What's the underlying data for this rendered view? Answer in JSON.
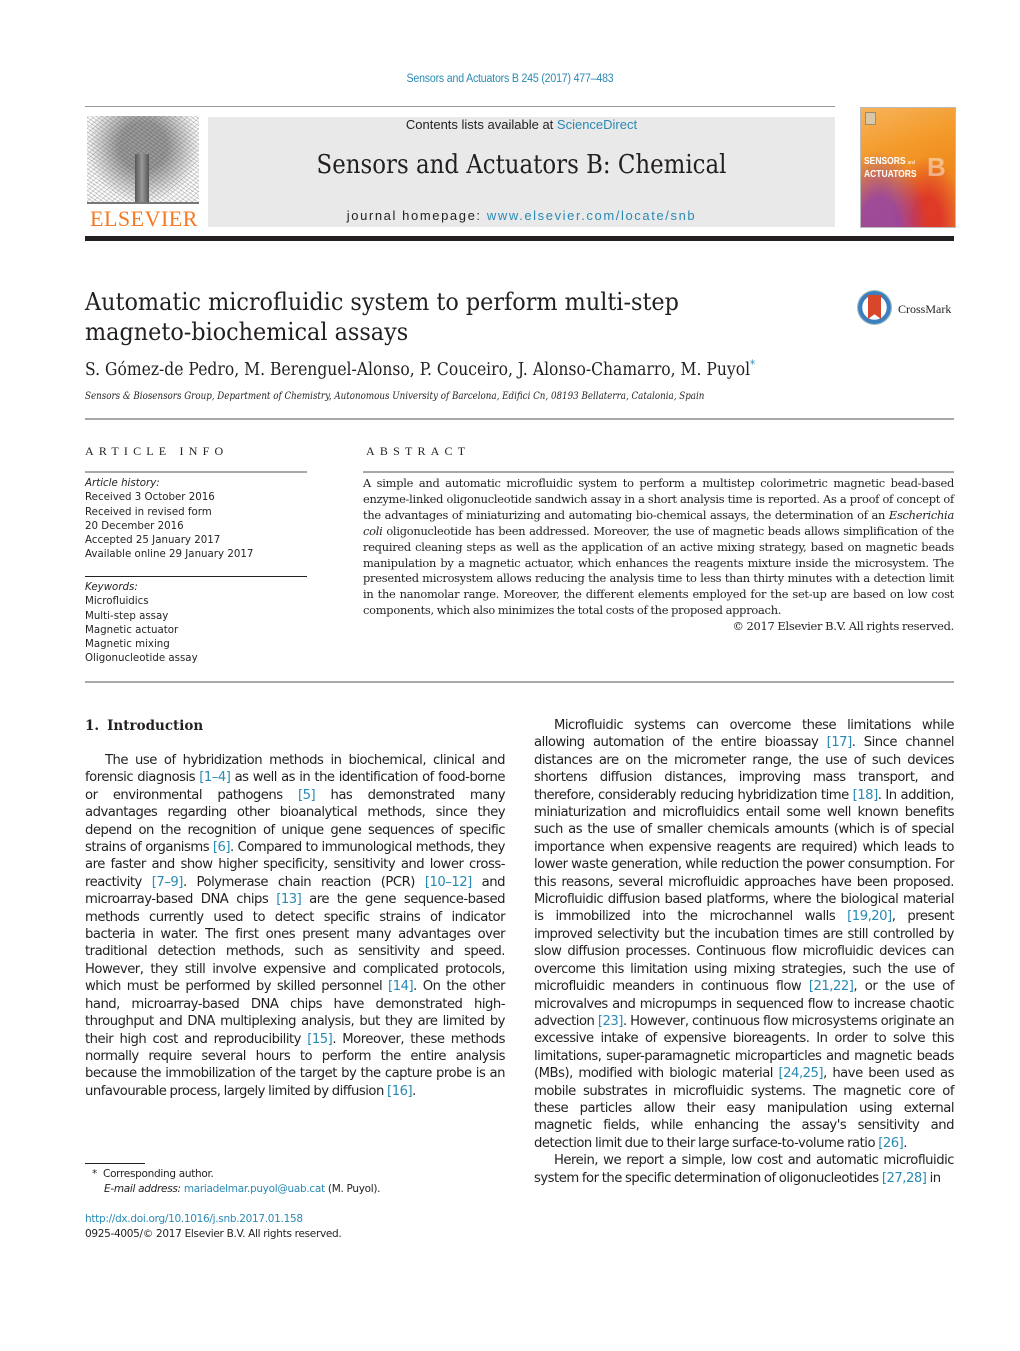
{
  "header": {
    "journal_ref": "Sensors and Actuators B 245 (2017) 477–483",
    "contents_prefix": "Contents lists available at ",
    "contents_link": "ScienceDirect",
    "journal_name": "Sensors and Actuators B: Chemical",
    "homepage_prefix": "journal homepage: ",
    "homepage_link": "www.elsevier.com/locate/snb",
    "publisher_logo_text": "ELSEVIER",
    "cover": {
      "line1": "SENSORS",
      "and": "and",
      "line2": "ACTUATORS",
      "letter": "B"
    },
    "colors": {
      "link": "#2a8ab3",
      "publisher": "#f47920"
    }
  },
  "article": {
    "title_line1": "Automatic microfluidic system to perform multi-step",
    "title_line2": "magneto-biochemical assays",
    "crossmark_label": "CrossMark",
    "authors": "S. Gómez-de Pedro, M. Berenguel-Alonso, P. Couceiro, J. Alonso-Chamarro, M. Puyol",
    "corresponding_mark": "*",
    "affiliation": "Sensors & Biosensors Group, Department of Chemistry, Autonomous University of Barcelona, Edifici Cn, 08193 Bellaterra, Catalonia, Spain"
  },
  "article_info": {
    "heading": "ARTICLE INFO",
    "history_label": "Article history:",
    "history": [
      "Received 3 October 2016",
      "Received in revised form",
      "20 December 2016",
      "Accepted 25 January 2017",
      "Available online 29 January 2017"
    ],
    "keywords_label": "Keywords:",
    "keywords": [
      "Microfluidics",
      "Multi-step assay",
      "Magnetic actuator",
      "Magnetic mixing",
      "Oligonucleotide assay"
    ]
  },
  "abstract": {
    "heading": "ABSTRACT",
    "text_before_italic": "A simple and automatic microfluidic system to perform a multistep colorimetric magnetic bead-based enzyme-linked oligonucleotide sandwich assay in a short analysis time is reported. As a proof of concept of the advantages of miniaturizing and automating bio-chemical assays, the determination of an ",
    "italic": "Escherichia coli",
    "text_after_italic": " oligonucleotide has been addressed. Moreover, the use of magnetic beads allows simplification of the required cleaning steps as well as the application of an active mixing strategy, based on magnetic beads manipulation by a magnetic actuator, which enhances the reagents mixture inside the microsystem. The presented microsystem allows reducing the analysis time to less than thirty minutes with a detection limit in the nanomolar range. Moreover, the different elements employed for the set-up are based on low cost components, which also minimizes the total costs of the proposed approach.",
    "copyright": "© 2017 Elsevier B.V. All rights reserved."
  },
  "introduction": {
    "number": "1.",
    "title": "Introduction",
    "para1": [
      {
        "t": "The use of hybridization methods in biochemical, clinical and forensic diagnosis "
      },
      {
        "ref": "[1–4]"
      },
      {
        "t": " as well as in the identification of food-borne or environmental pathogens "
      },
      {
        "ref": "[5]"
      },
      {
        "t": " has demonstrated many advantages regarding other bioanalytical methods, since they depend on the recognition of unique gene sequences of specific strains of organisms "
      },
      {
        "ref": "[6]"
      },
      {
        "t": ". Compared to immunological methods, they are faster and show higher specificity, sensitivity and lower cross-reactivity "
      },
      {
        "ref": "[7–9]"
      },
      {
        "t": ". Polymerase chain reaction (PCR) "
      },
      {
        "ref": "[10–12]"
      },
      {
        "t": " and microarray-based DNA chips "
      },
      {
        "ref": "[13]"
      },
      {
        "t": " are the gene sequence-based methods currently used to detect specific strains of indicator bacteria in water. The first ones present many advantages over traditional detection methods, such as sensitivity and speed. However, they still involve expensive and complicated protocols, which must be performed by skilled personnel "
      },
      {
        "ref": "[14]"
      },
      {
        "t": ". On the other hand, microarray-based DNA chips have demonstrated high-throughput and DNA multiplexing analysis, but they are limited by their high cost and reproducibility "
      },
      {
        "ref": "[15]"
      },
      {
        "t": ". Moreover, these methods normally require several hours to perform the entire analysis because the immobilization of the target by the capture probe is an unfavourable process, largely limited by diffusion "
      },
      {
        "ref": "[16]"
      },
      {
        "t": "."
      }
    ],
    "para2": [
      {
        "t": "Microfluidic systems can overcome these limitations while allowing automation of the entire bioassay "
      },
      {
        "ref": "[17]"
      },
      {
        "t": ". Since channel distances are on the micrometer range, the use of such devices shortens diffusion distances, improving mass transport, and therefore, considerably reducing hybridization time "
      },
      {
        "ref": "[18]"
      },
      {
        "t": ". In addition, miniaturization and microfluidics entail some well known benefits such as the use of smaller chemicals amounts (which is of special importance when expensive reagents are required) which leads to lower waste generation, while reduction the power consumption. For this reasons, several microfluidic approaches have been proposed. Microfluidic diffusion based platforms, where the biological material is immobilized into the microchannel walls "
      },
      {
        "ref": "[19,20]"
      },
      {
        "t": ", present improved selectivity but the incubation times are still controlled by slow diffusion processes. Continuous flow microfluidic devices can overcome this limitation using mixing strategies, such the use of microfluidic meanders in continuous flow "
      },
      {
        "ref": "[21,22]"
      },
      {
        "t": ", or the use of microvalves and micropumps in sequenced flow to increase chaotic advection "
      },
      {
        "ref": "[23]"
      },
      {
        "t": ". However, continuous flow microsystems originate an excessive intake of expensive bioreagents. In order to solve this limitations, super-paramagnetic microparticles and magnetic beads (MBs), modified with biologic material "
      },
      {
        "ref": "[24,25]"
      },
      {
        "t": ", have been used as mobile substrates in microfluidic systems. The magnetic core of these particles allow their easy manipulation using external magnetic fields, while enhancing the assay's sensitivity and detection limit due to their large surface-to-volume ratio "
      },
      {
        "ref": "[26]"
      },
      {
        "t": "."
      }
    ],
    "para3": [
      {
        "t": "Herein, we report a simple, low cost and automatic microfluidic system for the specific determination of oligonucleotides "
      },
      {
        "ref": "[27,28]"
      },
      {
        "t": " in"
      }
    ]
  },
  "footnotes": {
    "star": "*",
    "corresponding": "Corresponding author.",
    "email_label": "E-mail address:",
    "email": "mariadelmar.puyol@uab.cat",
    "email_suffix": " (M. Puyol).",
    "doi": "http://dx.doi.org/10.1016/j.snb.2017.01.158",
    "issn": "0925-4005/© 2017 Elsevier B.V. All rights reserved."
  }
}
